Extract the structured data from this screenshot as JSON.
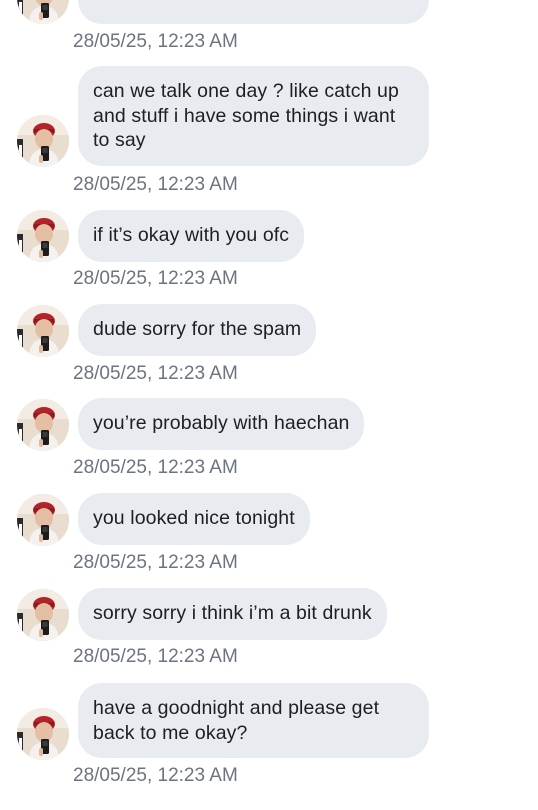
{
  "conversation": {
    "messages": [
      {
        "text": "",
        "timestamp": "28/05/25, 12:23 AM"
      },
      {
        "text": "can we talk one day ? like catch up and stuff i have some things i want to say",
        "timestamp": "28/05/25, 12:23 AM"
      },
      {
        "text": "if it’s okay with you ofc",
        "timestamp": "28/05/25, 12:23 AM"
      },
      {
        "text": "dude sorry for the spam",
        "timestamp": "28/05/25, 12:23 AM"
      },
      {
        "text": "you’re probably with haechan",
        "timestamp": "28/05/25, 12:23 AM"
      },
      {
        "text": "you looked nice tonight",
        "timestamp": "28/05/25, 12:23 AM"
      },
      {
        "text": "sorry sorry i think i’m a bit drunk",
        "timestamp": "28/05/25, 12:23 AM"
      },
      {
        "text": "have a goodnight and please get back to me okay?",
        "timestamp": "28/05/25, 12:23 AM"
      }
    ]
  },
  "colors": {
    "bubble_background": "#e8ebef",
    "message_text": "#1f1f1f",
    "timestamp_text": "#6b7480",
    "page_background": "#ffffff"
  },
  "icons": {
    "avatar": "sender-avatar-photo"
  }
}
